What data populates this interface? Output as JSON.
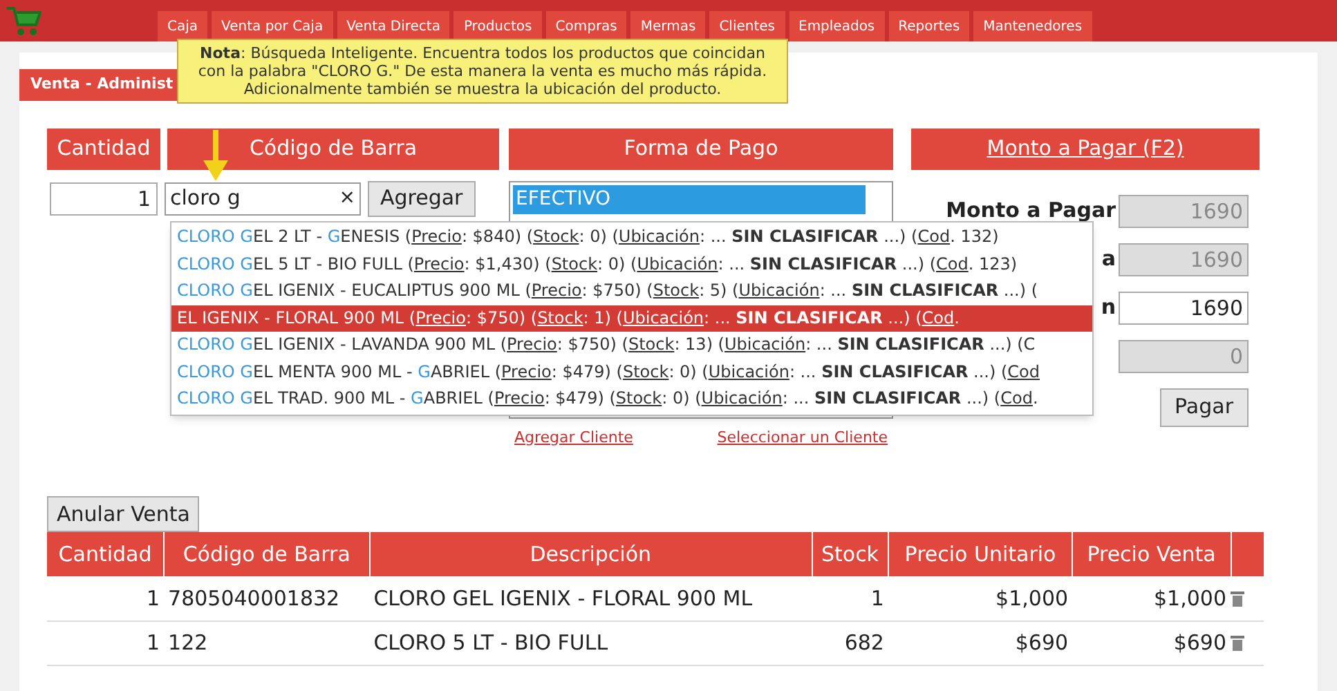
{
  "nav": {
    "items": [
      {
        "label": "Caja",
        "selected": false
      },
      {
        "label": "Venta por Caja",
        "selected": false
      },
      {
        "label": "Venta Directa",
        "selected": false
      },
      {
        "label": "Productos",
        "selected": false
      },
      {
        "label": "Compras",
        "selected": false
      },
      {
        "label": "Mermas",
        "selected": false
      },
      {
        "label": "Clientes",
        "selected": false
      },
      {
        "label": "Empleados",
        "selected": false
      },
      {
        "label": "Reportes",
        "selected": false
      },
      {
        "label": "Mantenedores",
        "selected": false
      }
    ]
  },
  "breadcrumb": "Venta - Administ",
  "tooltip": {
    "text": "**Nota**: Búsqueda Inteligente. Encuentra todos los productos que coincidan con la palabra \"CLORO G.\" De esta manera la venta es mucho más rápida. Adicionalmente también se muestra la ubicación del producto."
  },
  "entry": {
    "headers": [
      "Cantidad",
      "Código de Barra"
    ],
    "quantity": "1",
    "search_value": "cloro g",
    "clear": "×",
    "add_button": "Agregar"
  },
  "payment": {
    "header": "Forma de Pago",
    "selected_option": "EFECTIVO",
    "links": [
      "Agregar Cliente",
      "Seleccionar un Cliente"
    ]
  },
  "amount": {
    "header": "Monto a Pagar (F2)",
    "fields": [
      {
        "label": "Monto a Pagar",
        "value": "1690",
        "disabled": true
      },
      {
        "label": "a",
        "value": "1690",
        "disabled": true
      },
      {
        "label": "n",
        "value": "1690",
        "disabled": false
      },
      {
        "value": "0",
        "disabled": true
      }
    ],
    "pay_button": "Pagar"
  },
  "suggestions": [
    {
      "selected": false,
      "parts": [
        {
          "kind": "match",
          "text": "CLORO G"
        },
        {
          "kind": "plain",
          "text": "EL 2 LT - "
        },
        {
          "kind": "match",
          "text": "G"
        },
        {
          "kind": "plain",
          "text": "ENESIS ("
        },
        {
          "kind": "link",
          "text": "Precio"
        },
        {
          "kind": "plain",
          "text": ": $840) ("
        },
        {
          "kind": "link",
          "text": "Stock"
        },
        {
          "kind": "plain",
          "text": ": 0) ("
        },
        {
          "kind": "link",
          "text": "Ubicación"
        },
        {
          "kind": "plain",
          "text": ": ... "
        },
        {
          "kind": "bold",
          "text": "SIN CLASIFICAR"
        },
        {
          "kind": "plain",
          "text": " ...) ("
        },
        {
          "kind": "link",
          "text": "Cod"
        },
        {
          "kind": "plain",
          "text": ". 132)"
        }
      ]
    },
    {
      "selected": false,
      "parts": [
        {
          "kind": "match",
          "text": "CLORO G"
        },
        {
          "kind": "plain",
          "text": "EL 5 LT - BIO FULL ("
        },
        {
          "kind": "link",
          "text": "Precio"
        },
        {
          "kind": "plain",
          "text": ": $1,430) ("
        },
        {
          "kind": "link",
          "text": "Stock"
        },
        {
          "kind": "plain",
          "text": ": 0) ("
        },
        {
          "kind": "link",
          "text": "Ubicación"
        },
        {
          "kind": "plain",
          "text": ": ... "
        },
        {
          "kind": "bold",
          "text": "SIN CLASIFICAR"
        },
        {
          "kind": "plain",
          "text": " ...) ("
        },
        {
          "kind": "link",
          "text": "Cod"
        },
        {
          "kind": "plain",
          "text": ". 123)"
        }
      ]
    },
    {
      "selected": false,
      "parts": [
        {
          "kind": "match",
          "text": "CLORO G"
        },
        {
          "kind": "plain",
          "text": "EL IGENIX - EUCALIPTUS 900 ML ("
        },
        {
          "kind": "link",
          "text": "Precio"
        },
        {
          "kind": "plain",
          "text": ": $750) ("
        },
        {
          "kind": "link",
          "text": "Stock"
        },
        {
          "kind": "plain",
          "text": ": 5) ("
        },
        {
          "kind": "link",
          "text": "Ubicación"
        },
        {
          "kind": "plain",
          "text": ": ... "
        },
        {
          "kind": "bold",
          "text": "SIN CLASIFICAR"
        },
        {
          "kind": "plain",
          "text": " ...) ("
        }
      ]
    },
    {
      "selected": true,
      "parts": [
        {
          "kind": "plain",
          "text": "EL IGENIX - FLORAL 900 ML ("
        },
        {
          "kind": "link",
          "text": "Precio"
        },
        {
          "kind": "plain",
          "text": ": $750) ("
        },
        {
          "kind": "link",
          "text": "Stock"
        },
        {
          "kind": "plain",
          "text": ": 1) ("
        },
        {
          "kind": "link",
          "text": "Ubicación"
        },
        {
          "kind": "plain",
          "text": ": ... "
        },
        {
          "kind": "bold",
          "text": "SIN CLASIFICAR"
        },
        {
          "kind": "plain",
          "text": " ...) ("
        },
        {
          "kind": "link",
          "text": "Cod"
        },
        {
          "kind": "plain",
          "text": "."
        }
      ]
    },
    {
      "selected": false,
      "parts": [
        {
          "kind": "match",
          "text": "CLORO G"
        },
        {
          "kind": "plain",
          "text": "EL IGENIX - LAVANDA 900 ML ("
        },
        {
          "kind": "link",
          "text": "Precio"
        },
        {
          "kind": "plain",
          "text": ": $750) ("
        },
        {
          "kind": "link",
          "text": "Stock"
        },
        {
          "kind": "plain",
          "text": ": 13) ("
        },
        {
          "kind": "link",
          "text": "Ubicación"
        },
        {
          "kind": "plain",
          "text": ": ... "
        },
        {
          "kind": "bold",
          "text": "SIN CLASIFICAR"
        },
        {
          "kind": "plain",
          "text": " ...) (C"
        }
      ]
    },
    {
      "selected": false,
      "parts": [
        {
          "kind": "match",
          "text": "CLORO G"
        },
        {
          "kind": "plain",
          "text": "EL MENTA 900 ML - "
        },
        {
          "kind": "match",
          "text": "G"
        },
        {
          "kind": "plain",
          "text": "ABRIEL ("
        },
        {
          "kind": "link",
          "text": "Precio"
        },
        {
          "kind": "plain",
          "text": ": $479) ("
        },
        {
          "kind": "link",
          "text": "Stock"
        },
        {
          "kind": "plain",
          "text": ": 0) ("
        },
        {
          "kind": "link",
          "text": "Ubicación"
        },
        {
          "kind": "plain",
          "text": ": ... "
        },
        {
          "kind": "bold",
          "text": "SIN CLASIFICAR"
        },
        {
          "kind": "plain",
          "text": " ...) ("
        },
        {
          "kind": "link",
          "text": "Cod"
        }
      ]
    },
    {
      "selected": false,
      "parts": [
        {
          "kind": "match",
          "text": "CLORO G"
        },
        {
          "kind": "plain",
          "text": "EL TRAD. 900 ML - "
        },
        {
          "kind": "match",
          "text": "G"
        },
        {
          "kind": "plain",
          "text": "ABRIEL ("
        },
        {
          "kind": "link",
          "text": "Precio"
        },
        {
          "kind": "plain",
          "text": ": $479) ("
        },
        {
          "kind": "link",
          "text": "Stock"
        },
        {
          "kind": "plain",
          "text": ": 0) ("
        },
        {
          "kind": "link",
          "text": "Ubicación"
        },
        {
          "kind": "plain",
          "text": ": ... "
        },
        {
          "kind": "bold",
          "text": "SIN CLASIFICAR"
        },
        {
          "kind": "plain",
          "text": " ...) ("
        },
        {
          "kind": "link",
          "text": "Cod"
        },
        {
          "kind": "plain",
          "text": "."
        }
      ]
    }
  ],
  "cancel_button": "Anular Venta",
  "table": {
    "columns": [
      "Cantidad",
      "Código de Barra",
      "Descripción",
      "Stock",
      "Precio Unitario",
      "Precio Venta"
    ],
    "rows": [
      [
        "1",
        "7805040001832",
        "CLORO GEL IGENIX - FLORAL 900 ML",
        "1",
        "$1,000",
        "$1,000"
      ],
      [
        "1",
        "122",
        "CLORO 5 LT - BIO FULL",
        "682",
        "$690",
        "$690"
      ]
    ]
  }
}
